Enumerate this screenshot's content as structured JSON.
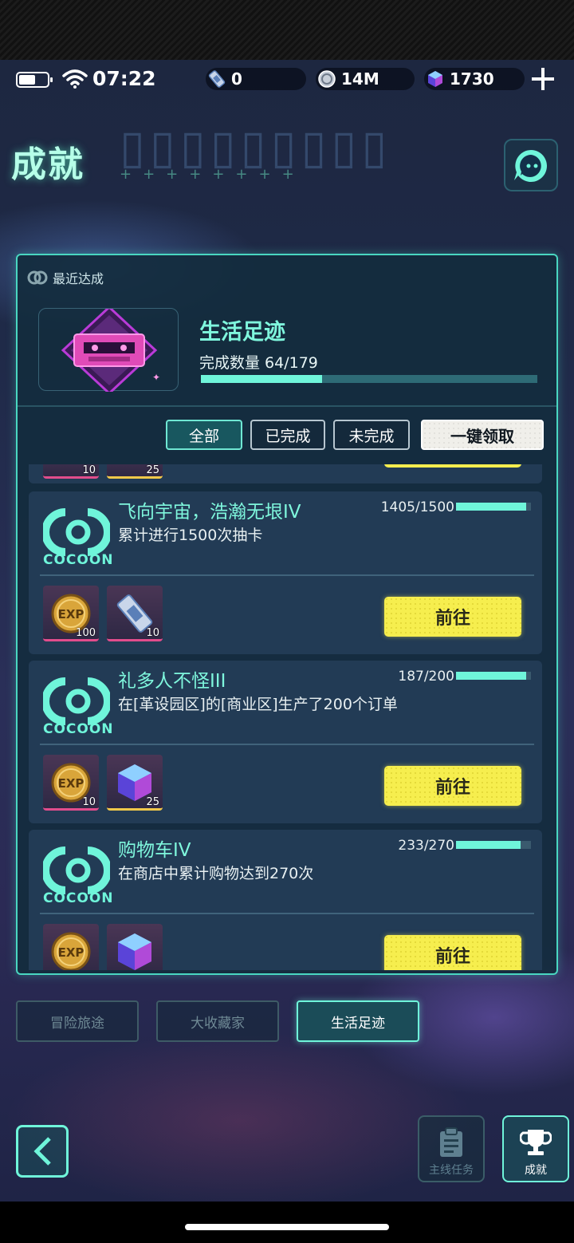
{
  "status_bar": {
    "time": "07:22",
    "resources": [
      {
        "icon": "ticket-icon",
        "value": "0"
      },
      {
        "icon": "coin-icon",
        "value": "14M"
      },
      {
        "icon": "cube-gem-icon",
        "value": "1730"
      }
    ]
  },
  "header": {
    "title": "成就"
  },
  "panel": {
    "recent_label": "最近达成",
    "category_title": "生活足迹",
    "progress_label": "完成数量 64/179",
    "progress_fraction": 0.36,
    "filters": [
      "全部",
      "已完成",
      "未完成"
    ],
    "claim_all_label": "一键领取",
    "logo_text": "COCOON",
    "go_label": "前往",
    "achievements": [
      {
        "name": "飞向宇宙，浩瀚无垠IV",
        "desc": "累计进行1500次抽卡",
        "count": "1405/1500",
        "fraction": 0.937,
        "rewards": [
          {
            "icon": "exp-coin-icon",
            "qty": "100"
          },
          {
            "icon": "ticket-icon",
            "qty": "10"
          }
        ]
      },
      {
        "name": "礼多人不怪III",
        "desc": "在[革设园区]的[商业区]生产了200个订单",
        "count": "187/200",
        "fraction": 0.935,
        "rewards": [
          {
            "icon": "exp-coin-icon",
            "qty": "10"
          },
          {
            "icon": "cube-gem-icon",
            "qty": "25"
          }
        ]
      },
      {
        "name": "购物车IV",
        "desc": "在商店中累计购物达到270次",
        "count": "233/270",
        "fraction": 0.863,
        "rewards": [
          {
            "icon": "exp-coin-icon",
            "qty": ""
          },
          {
            "icon": "cube-gem-icon",
            "qty": ""
          }
        ]
      }
    ],
    "stub_rewards": [
      "10",
      "25"
    ]
  },
  "category_tabs": [
    "冒险旅途",
    "大收藏家",
    "生活足迹"
  ],
  "bottom_nav": {
    "main_quest": "主线任务",
    "achievements": "成就"
  },
  "colors": {
    "accent": "#6ff5da",
    "go_button": "#f6ee4e",
    "panel_border": "#49d7c1"
  }
}
